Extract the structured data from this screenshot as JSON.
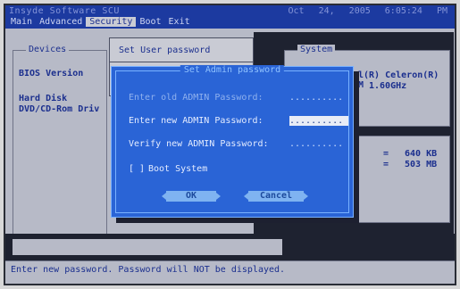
{
  "titlebar": {
    "vendor": "Insyde Software SCU",
    "datetime": "Oct 24, 2005   6:05:24   PM"
  },
  "menu": {
    "items": [
      "Main",
      "Advanced",
      "Security",
      "Boot",
      "Exit"
    ],
    "active": "Security"
  },
  "dropdown": {
    "set_user_password": "Set User password"
  },
  "devices": {
    "title": "Devices",
    "bios_version": "BIOS Version",
    "hard_disk": "Hard Disk",
    "dvd_rom": "DVD/CD-Rom Driv"
  },
  "system": {
    "title": "System",
    "cpu_line1": "l(R) Celeron(R) M",
    "cpu_line2": "1.60GHz",
    "mem1_eq": "=",
    "mem1_val": "640 KB",
    "mem2_eq": "=",
    "mem2_val": "503 MB"
  },
  "dialog": {
    "title": "Set Admin password",
    "old_label": "Enter old ADMIN Password:",
    "old_value": "..........",
    "new_label": "Enter new ADMIN Password:",
    "new_value": "..........",
    "verify_label": "Verify new ADMIN Password:",
    "verify_value": "..........",
    "boot_checkbox": "[ ]",
    "boot_label": "Boot System",
    "ok_label": "OK",
    "cancel_label": "Cancel"
  },
  "status": {
    "text": "Enter new password. Password will NOT be displayed."
  }
}
